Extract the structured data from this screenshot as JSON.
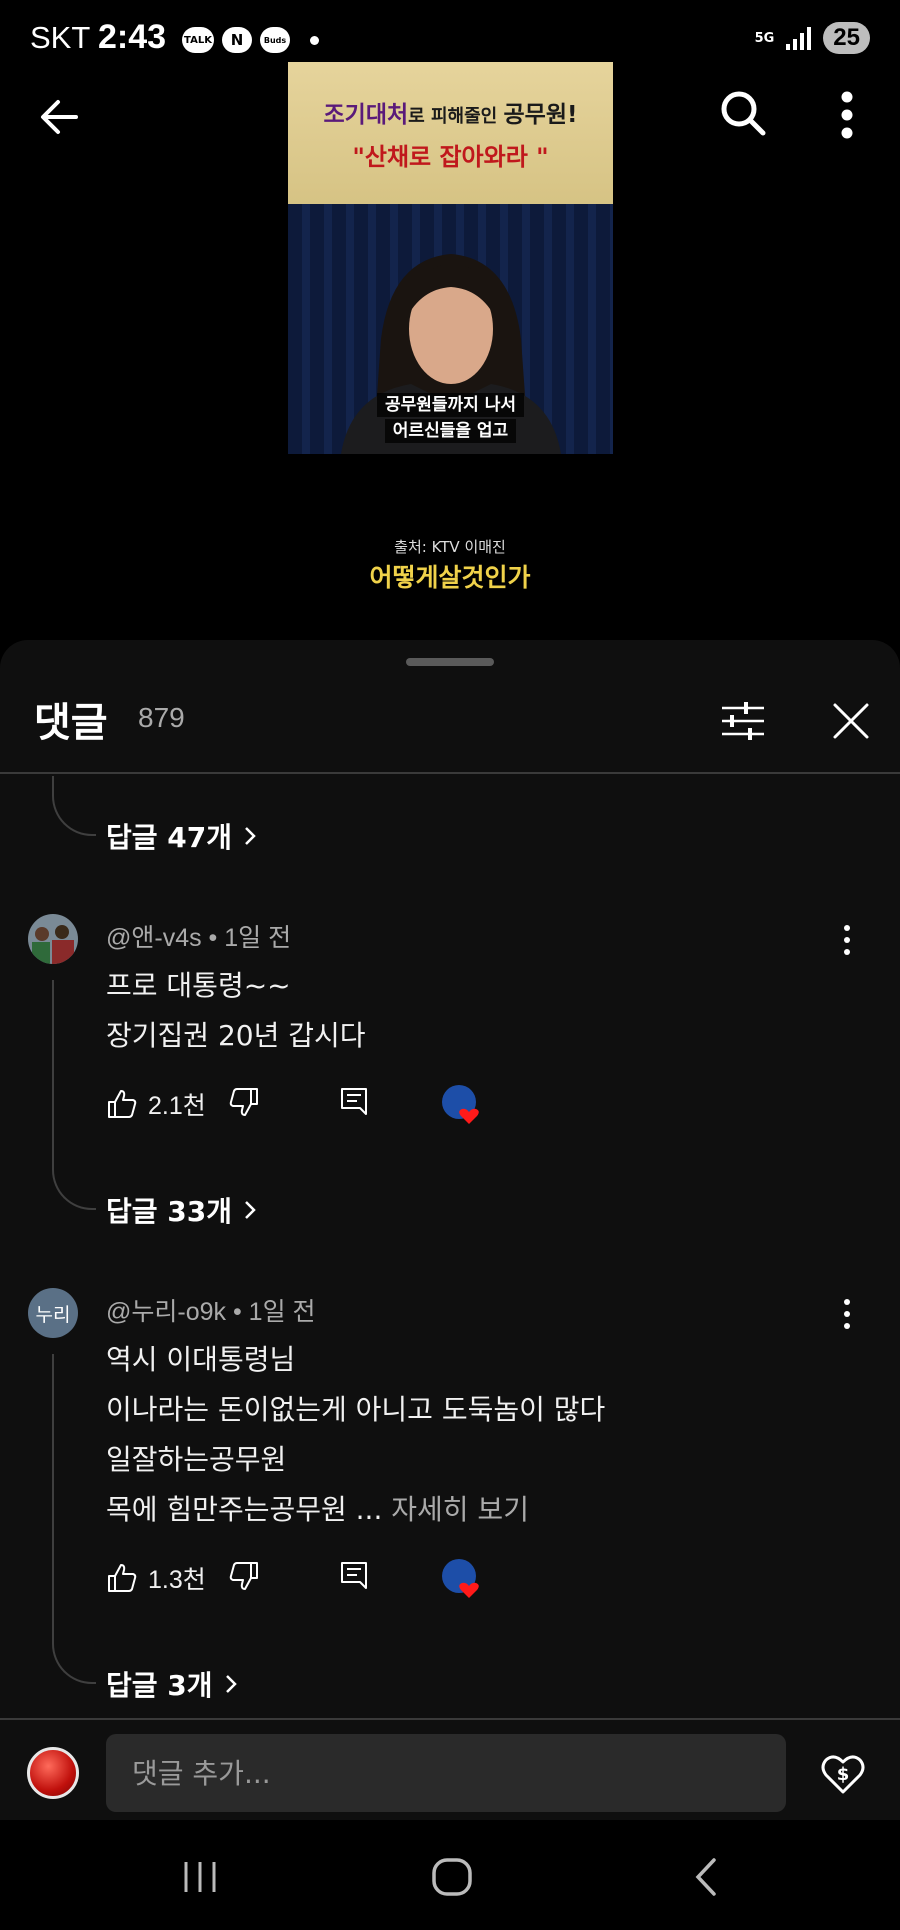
{
  "status_bar": {
    "carrier": "SKT",
    "time": "2:43",
    "notification_icons": [
      "TALK",
      "N",
      "Buds"
    ],
    "network": "5G",
    "battery": "25"
  },
  "video": {
    "title_highlight": "조기대처",
    "title_rest_1": "로 피해줄인 ",
    "title_rest_2": "공무원!",
    "title_line2": "\"산채로 잡아와라 \"",
    "subtitle_line1": "공무원들까지 나서",
    "subtitle_line2": "어르신들을 업고",
    "source": "출처: KTV 이매진",
    "channel": "어떻게살것인가"
  },
  "comments_sheet": {
    "title": "댓글",
    "count": "879",
    "input_placeholder": "댓글 추가..."
  },
  "top_replies": {
    "label": "답글 47개"
  },
  "comments": [
    {
      "author": "@앤-v4s",
      "time": "1일 전",
      "lines": [
        "프로 대통령~~",
        "장기집권 20년 갑시다"
      ],
      "likes": "2.1천",
      "replies": "답글 33개"
    },
    {
      "author": "@누리-o9k",
      "time": "1일 전",
      "avatar_text": "누리",
      "lines": [
        "역시 이대통령님",
        "이나라는 돈이없는게 아니고 도둑놈이 많다",
        "일잘하는공무원",
        "목에 힘만주는공무원 ..."
      ],
      "more": "자세히 보기",
      "likes": "1.3천",
      "replies": "답글 3개"
    }
  ],
  "colors": {
    "accent_heart": "#ff1a1a",
    "sheet_bg": "#0f0f0f",
    "channel_yellow": "#f0d24a"
  }
}
